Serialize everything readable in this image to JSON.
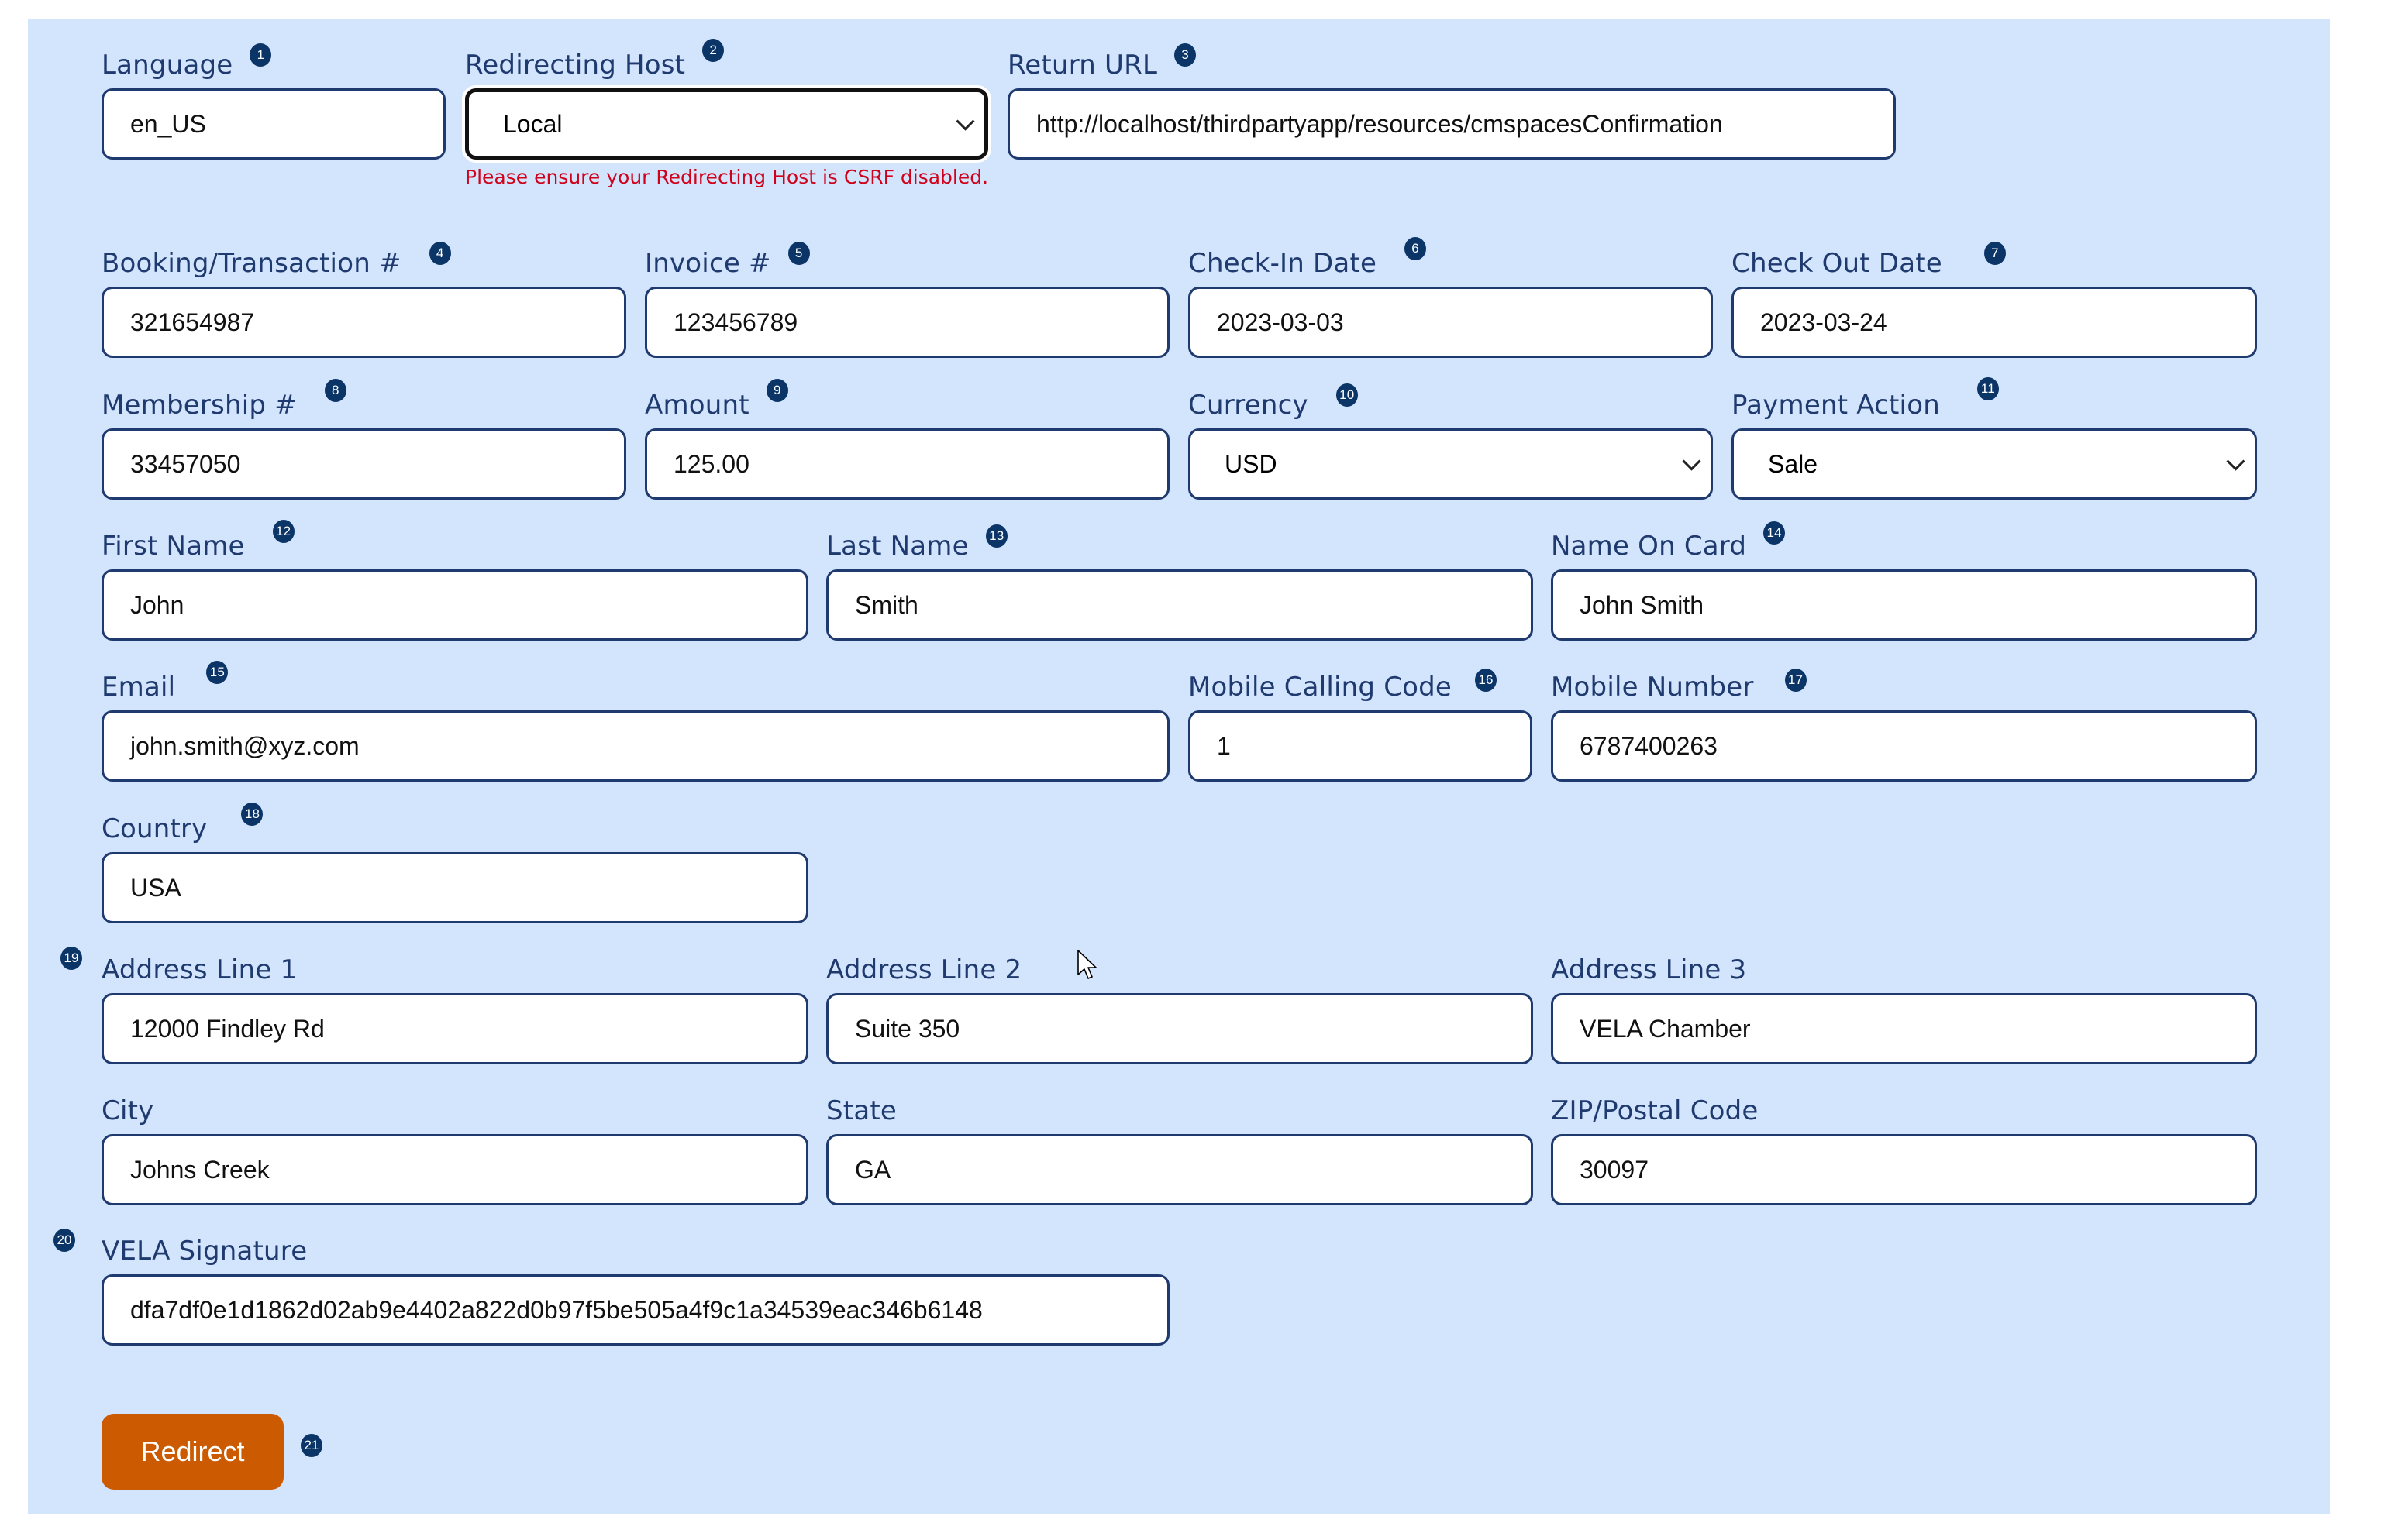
{
  "form": {
    "language": {
      "label": "Language",
      "badge": "1",
      "value": "en_US"
    },
    "redirecting_host": {
      "label": "Redirecting Host",
      "badge": "2",
      "selected": "Local",
      "error": "Please ensure your Redirecting Host is CSRF disabled."
    },
    "return_url": {
      "label": "Return URL",
      "badge": "3",
      "value": "http://localhost/thirdpartyapp/resources/cmspacesConfirmation"
    },
    "booking": {
      "label": "Booking/Transaction #",
      "badge": "4",
      "value": "321654987"
    },
    "invoice": {
      "label": "Invoice #",
      "badge": "5",
      "value": "123456789"
    },
    "check_in": {
      "label": "Check-In Date",
      "badge": "6",
      "value": "2023-03-03"
    },
    "check_out": {
      "label": "Check Out Date",
      "badge": "7",
      "value": "2023-03-24"
    },
    "membership": {
      "label": "Membership #",
      "badge": "8",
      "value": "33457050"
    },
    "amount": {
      "label": "Amount",
      "badge": "9",
      "value": "125.00"
    },
    "currency": {
      "label": "Currency",
      "badge": "10",
      "selected": "USD"
    },
    "payment_action": {
      "label": "Payment Action",
      "badge": "11",
      "selected": "Sale"
    },
    "first_name": {
      "label": "First Name",
      "badge": "12",
      "value": "John"
    },
    "last_name": {
      "label": "Last Name",
      "badge": "13",
      "value": "Smith"
    },
    "name_on_card": {
      "label": "Name On Card",
      "badge": "14",
      "value": "John Smith"
    },
    "email": {
      "label": "Email",
      "badge": "15",
      "value": "john.smith@xyz.com"
    },
    "mobile_calling_code": {
      "label": "Mobile Calling Code",
      "badge": "16",
      "value": "1"
    },
    "mobile_number": {
      "label": "Mobile Number",
      "badge": "17",
      "value": "6787400263"
    },
    "country": {
      "label": "Country",
      "badge": "18",
      "value": "USA"
    },
    "address_badge": "19",
    "address_line_1": {
      "label": "Address Line 1",
      "value": "12000 Findley Rd"
    },
    "address_line_2": {
      "label": "Address Line 2",
      "value": "Suite 350"
    },
    "address_line_3": {
      "label": "Address Line 3",
      "value": "VELA Chamber"
    },
    "city": {
      "label": "City",
      "value": "Johns Creek"
    },
    "state": {
      "label": "State",
      "value": "GA"
    },
    "zip": {
      "label": "ZIP/Postal Code",
      "value": "30097"
    },
    "signature_badge": "20",
    "vela_signature": {
      "label": "VELA Signature",
      "value": "dfa7df0e1d1862d02ab9e4402a822d0b97f5be505a4f9c1a34539eac346b6148"
    },
    "redirect": {
      "label": "Redirect",
      "badge": "21"
    }
  },
  "colors": {
    "panel_bg": "#d3e4fd",
    "label": "#1f3a6e",
    "badge": "#0b3467",
    "error": "#d0021b",
    "button": "#cc5a00"
  }
}
